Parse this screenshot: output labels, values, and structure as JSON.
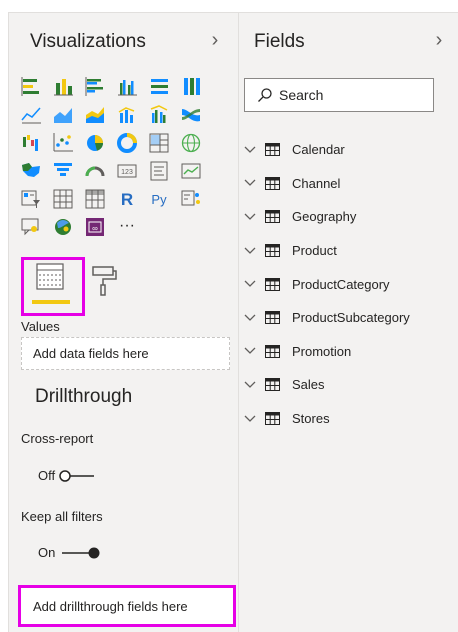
{
  "visualizations": {
    "title": "Visualizations",
    "collapse_icon": "chevron-right-icon",
    "icons": [
      "stacked-bar-chart-icon",
      "stacked-column-chart-icon",
      "clustered-bar-chart-icon",
      "clustered-column-chart-icon",
      "100-stacked-bar-chart-icon",
      "100-stacked-column-chart-icon",
      "line-chart-icon",
      "area-chart-icon",
      "stacked-area-chart-icon",
      "line-and-stacked-column-chart-icon",
      "line-and-clustered-column-chart-icon",
      "ribbon-chart-icon",
      "waterfall-chart-icon",
      "scatter-chart-icon",
      "pie-chart-icon",
      "donut-chart-icon",
      "treemap-icon",
      "map-icon",
      "filled-map-icon",
      "funnel-icon",
      "gauge-icon",
      "card-icon",
      "multi-row-card-icon",
      "kpi-icon",
      "slicer-icon",
      "table-icon",
      "matrix-icon",
      "r-script-visual-icon",
      "python-visual-icon",
      "key-influencers-icon",
      "qa-visual-icon",
      "arcgis-map-icon",
      "power-apps-icon",
      "more-visuals-icon"
    ],
    "r_glyph": "R",
    "py_glyph": "Py",
    "more_glyph": "···"
  },
  "tabs": {
    "fields_tab_icon": "fields-tab-icon",
    "format_tab_icon": "paint-roller-icon",
    "accent": "#f2c811"
  },
  "values_well": {
    "label": "Values",
    "placeholder": "Add data fields here"
  },
  "drillthrough": {
    "heading": "Drillthrough",
    "cross_report": {
      "label": "Cross-report",
      "state_text": "Off",
      "on": false
    },
    "keep_all_filters": {
      "label": "Keep all filters",
      "state_text": "On",
      "on": true
    },
    "drop_well": "Add drillthrough fields here"
  },
  "fields": {
    "title": "Fields",
    "collapse_icon": "chevron-right-icon",
    "search_placeholder": "Search",
    "tables": [
      "Calendar",
      "Channel",
      "Geography",
      "Product",
      "ProductCategory",
      "ProductSubcategory",
      "Promotion",
      "Sales",
      "Stores"
    ]
  },
  "colors": {
    "pane_bg": "#f3f2f1",
    "highlight": "#e600e6",
    "powerbi_yellow": "#f2c811",
    "chart_blue": "#118dff",
    "chart_green": "#2e7d32"
  }
}
